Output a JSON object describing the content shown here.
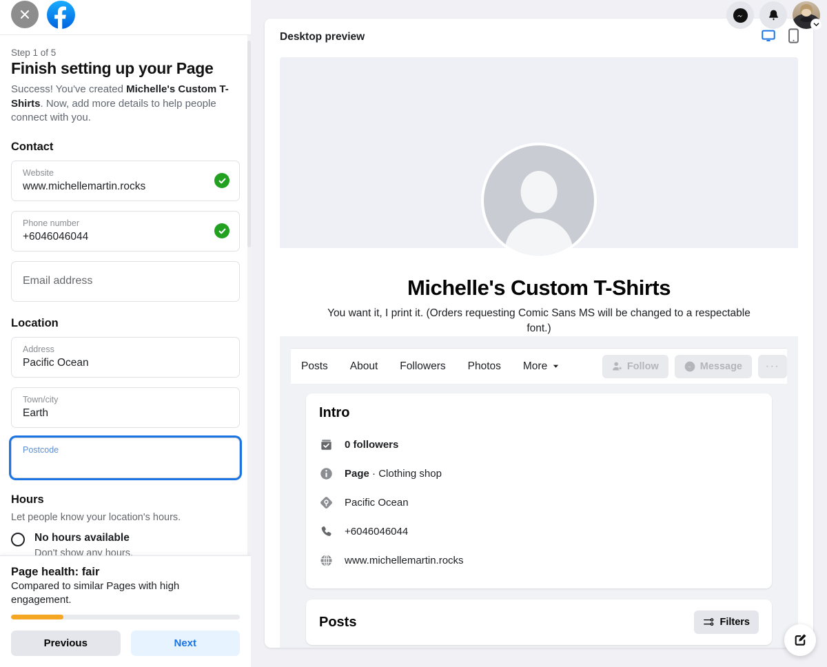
{
  "sidebar": {
    "close_icon": "close-icon",
    "brand_icon": "facebook-logo",
    "step_label": "Step 1 of 5",
    "title": "Finish setting up your Page",
    "desc_part1": "Success! You've created ",
    "desc_bold": "Michelle's Custom T-Shirts",
    "desc_part2": ". Now, add more details to help people connect with you.",
    "contact": {
      "heading": "Contact",
      "fields": [
        {
          "label": "Website",
          "value": "www.michellemartin.rocks",
          "verified": true
        },
        {
          "label": "Phone number",
          "value": "+6046046044",
          "verified": true
        },
        {
          "label": "Email address",
          "value": "",
          "placeholder": "Email address",
          "verified": false
        }
      ]
    },
    "location": {
      "heading": "Location",
      "fields": [
        {
          "label": "Address",
          "value": "Pacific Ocean"
        },
        {
          "label": "Town/city",
          "value": "Earth"
        },
        {
          "label": "Postcode",
          "value": "",
          "focused": true
        }
      ]
    },
    "hours": {
      "heading": "Hours",
      "desc": "Let people know your location's hours.",
      "option_label": "No hours available",
      "option_sub": "Don't show any hours.",
      "selected": false
    },
    "footer": {
      "health_title": "Page health: fair",
      "health_desc": "Compared to similar Pages with high engagement.",
      "health_percent": 23,
      "health_color": "#f5a623",
      "previous_label": "Previous",
      "next_label": "Next"
    }
  },
  "topnav": {
    "messenger_icon": "messenger-icon",
    "notifications_icon": "bell-icon",
    "avatar_icon": "avatar",
    "chevron_icon": "chevron-down-icon"
  },
  "preview": {
    "title": "Desktop preview",
    "desktop_icon": "desktop-icon",
    "mobile_icon": "mobile-icon",
    "active_device": "desktop",
    "accent_color": "#1b74e4"
  },
  "page": {
    "profile_icon": "profile-placeholder-icon",
    "name": "Michelle's Custom T-Shirts",
    "bio": "You want it, I print it. (Orders requesting Comic Sans MS will be changed to a respectable font.)",
    "tabs": [
      {
        "label": "Posts"
      },
      {
        "label": "About"
      },
      {
        "label": "Followers"
      },
      {
        "label": "Photos"
      },
      {
        "label": "More",
        "has_chevron": true
      }
    ],
    "actions": {
      "follow_label": "Follow",
      "follow_icon": "person-add-icon",
      "message_label": "Message",
      "message_icon": "messenger-icon",
      "more_label": "···"
    },
    "intro": {
      "title": "Intro",
      "items": [
        {
          "icon": "followers-check-icon",
          "text": "0 followers",
          "bold": true
        },
        {
          "icon": "info-icon",
          "bold_prefix": "Page",
          "text": " · Clothing shop"
        },
        {
          "icon": "location-pin-icon",
          "text": "Pacific Ocean"
        },
        {
          "icon": "phone-icon",
          "text": "+6046046044"
        },
        {
          "icon": "globe-icon",
          "text": "www.michellemartin.rocks"
        }
      ]
    },
    "posts": {
      "title": "Posts",
      "filters_label": "Filters",
      "filters_icon": "sliders-icon"
    }
  },
  "fab": {
    "icon": "compose-icon"
  }
}
